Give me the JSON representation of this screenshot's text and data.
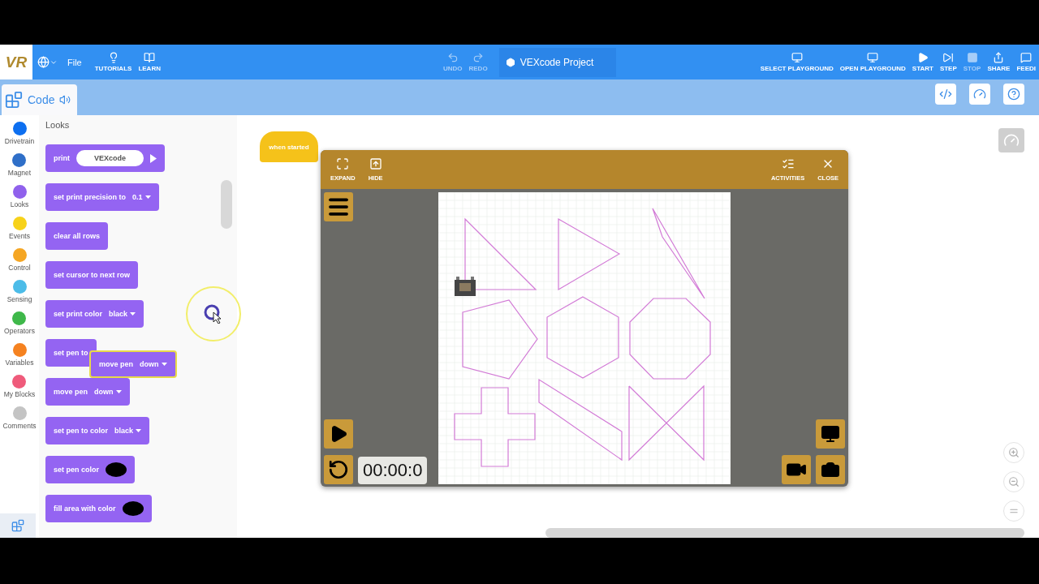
{
  "top_bar": {
    "logo": "VR",
    "file_menu": "File",
    "tools": [
      {
        "kind": "bulb",
        "label": "TUTORIALS"
      },
      {
        "kind": "book",
        "label": "LEARN"
      }
    ],
    "history": [
      {
        "kind": "undo",
        "label": "UNDO",
        "disabled": true
      },
      {
        "kind": "redo",
        "label": "REDO",
        "disabled": true
      }
    ],
    "project_title": "VEXcode Project",
    "actions": [
      {
        "kind": "select",
        "label": "SELECT PLAYGROUND",
        "disabled": false
      },
      {
        "kind": "open",
        "label": "OPEN PLAYGROUND",
        "disabled": false
      },
      {
        "kind": "start",
        "label": "START",
        "disabled": false
      },
      {
        "kind": "step",
        "label": "STEP",
        "disabled": false
      },
      {
        "kind": "stop",
        "label": "STOP",
        "disabled": true
      },
      {
        "kind": "share",
        "label": "SHARE",
        "disabled": false
      },
      {
        "kind": "feedback",
        "label": "FEEDI",
        "disabled": false
      }
    ]
  },
  "code_tab": {
    "label": "Code"
  },
  "categories": [
    {
      "name": "Drivetrain",
      "color": "#0d6ff0"
    },
    {
      "name": "Magnet",
      "color": "#2f6fc8"
    },
    {
      "name": "Looks",
      "color": "#9061ec"
    },
    {
      "name": "Events",
      "color": "#f7d21a"
    },
    {
      "name": "Control",
      "color": "#f5a623"
    },
    {
      "name": "Sensing",
      "color": "#4cbce8"
    },
    {
      "name": "Operators",
      "color": "#3fb84a"
    },
    {
      "name": "Variables",
      "color": "#f58220"
    },
    {
      "name": "My Blocks",
      "color": "#ef5b7b"
    },
    {
      "name": "Comments",
      "color": "#c4c4c4"
    }
  ],
  "palette": {
    "title": "Looks",
    "blocks": [
      {
        "parts": [
          {
            "kind": "text",
            "text": "print"
          },
          {
            "kind": "input",
            "text": "VEXcode"
          },
          {
            "kind": "arrow"
          }
        ]
      },
      {
        "parts": [
          {
            "kind": "text",
            "text": "set print precision to"
          },
          {
            "kind": "dropdown",
            "text": "0.1"
          }
        ]
      },
      {
        "parts": [
          {
            "kind": "text",
            "text": "clear all rows"
          }
        ]
      },
      {
        "parts": [
          {
            "kind": "text",
            "text": "set cursor to next row"
          }
        ]
      },
      {
        "parts": [
          {
            "kind": "text",
            "text": "set print color"
          },
          {
            "kind": "dropdown",
            "text": "black"
          }
        ]
      },
      {
        "parts": [
          {
            "kind": "text",
            "text": "set pen to"
          }
        ]
      },
      {
        "parts": [
          {
            "kind": "text",
            "text": "move pen"
          },
          {
            "kind": "dropdown",
            "text": "down"
          }
        ]
      },
      {
        "parts": [
          {
            "kind": "text",
            "text": "set pen to color"
          },
          {
            "kind": "dropdown",
            "text": "black"
          }
        ]
      },
      {
        "parts": [
          {
            "kind": "text",
            "text": "set pen color"
          },
          {
            "kind": "color",
            "color": "#000000"
          }
        ]
      },
      {
        "parts": [
          {
            "kind": "text",
            "text": "fill area with color"
          },
          {
            "kind": "color",
            "color": "#000000"
          }
        ]
      }
    ]
  },
  "dragged_block": {
    "parts": [
      {
        "kind": "text",
        "text": "move pen"
      },
      {
        "kind": "dropdown",
        "text": "down"
      }
    ]
  },
  "workspace": {
    "hat_block": "when started"
  },
  "playground": {
    "toolbar": [
      {
        "kind": "expand",
        "label": "EXPAND"
      },
      {
        "kind": "hide",
        "label": "HIDE"
      },
      {
        "kind": "activities",
        "label": "ACTIVITIES"
      },
      {
        "kind": "close",
        "label": "CLOSE"
      }
    ],
    "timer": "00:00:0"
  }
}
